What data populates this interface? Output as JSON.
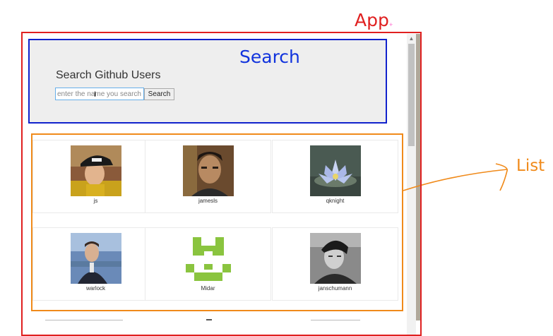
{
  "annotations": {
    "app_label": "App",
    "app_plus": "+",
    "search_label": "Search",
    "list_label": "List"
  },
  "search": {
    "heading": "Search Github Users",
    "placeholder": "enter the name you search",
    "button_label": "Search"
  },
  "users": [
    {
      "login": "js",
      "avatar_icon": "avatar-man-cap"
    },
    {
      "login": "jamesls",
      "avatar_icon": "avatar-man-portrait"
    },
    {
      "login": "qknight",
      "avatar_icon": "avatar-water-lily"
    },
    {
      "login": "warlock",
      "avatar_icon": "avatar-man-suit"
    },
    {
      "login": "Midar",
      "avatar_icon": "avatar-green-identicon"
    },
    {
      "login": "janschumann",
      "avatar_icon": "avatar-man-bw"
    }
  ],
  "colors": {
    "app_annotation": "#e02020",
    "search_annotation": "#1133dd",
    "list_annotation": "#f08a1a",
    "identicon": "#8ac43f"
  }
}
